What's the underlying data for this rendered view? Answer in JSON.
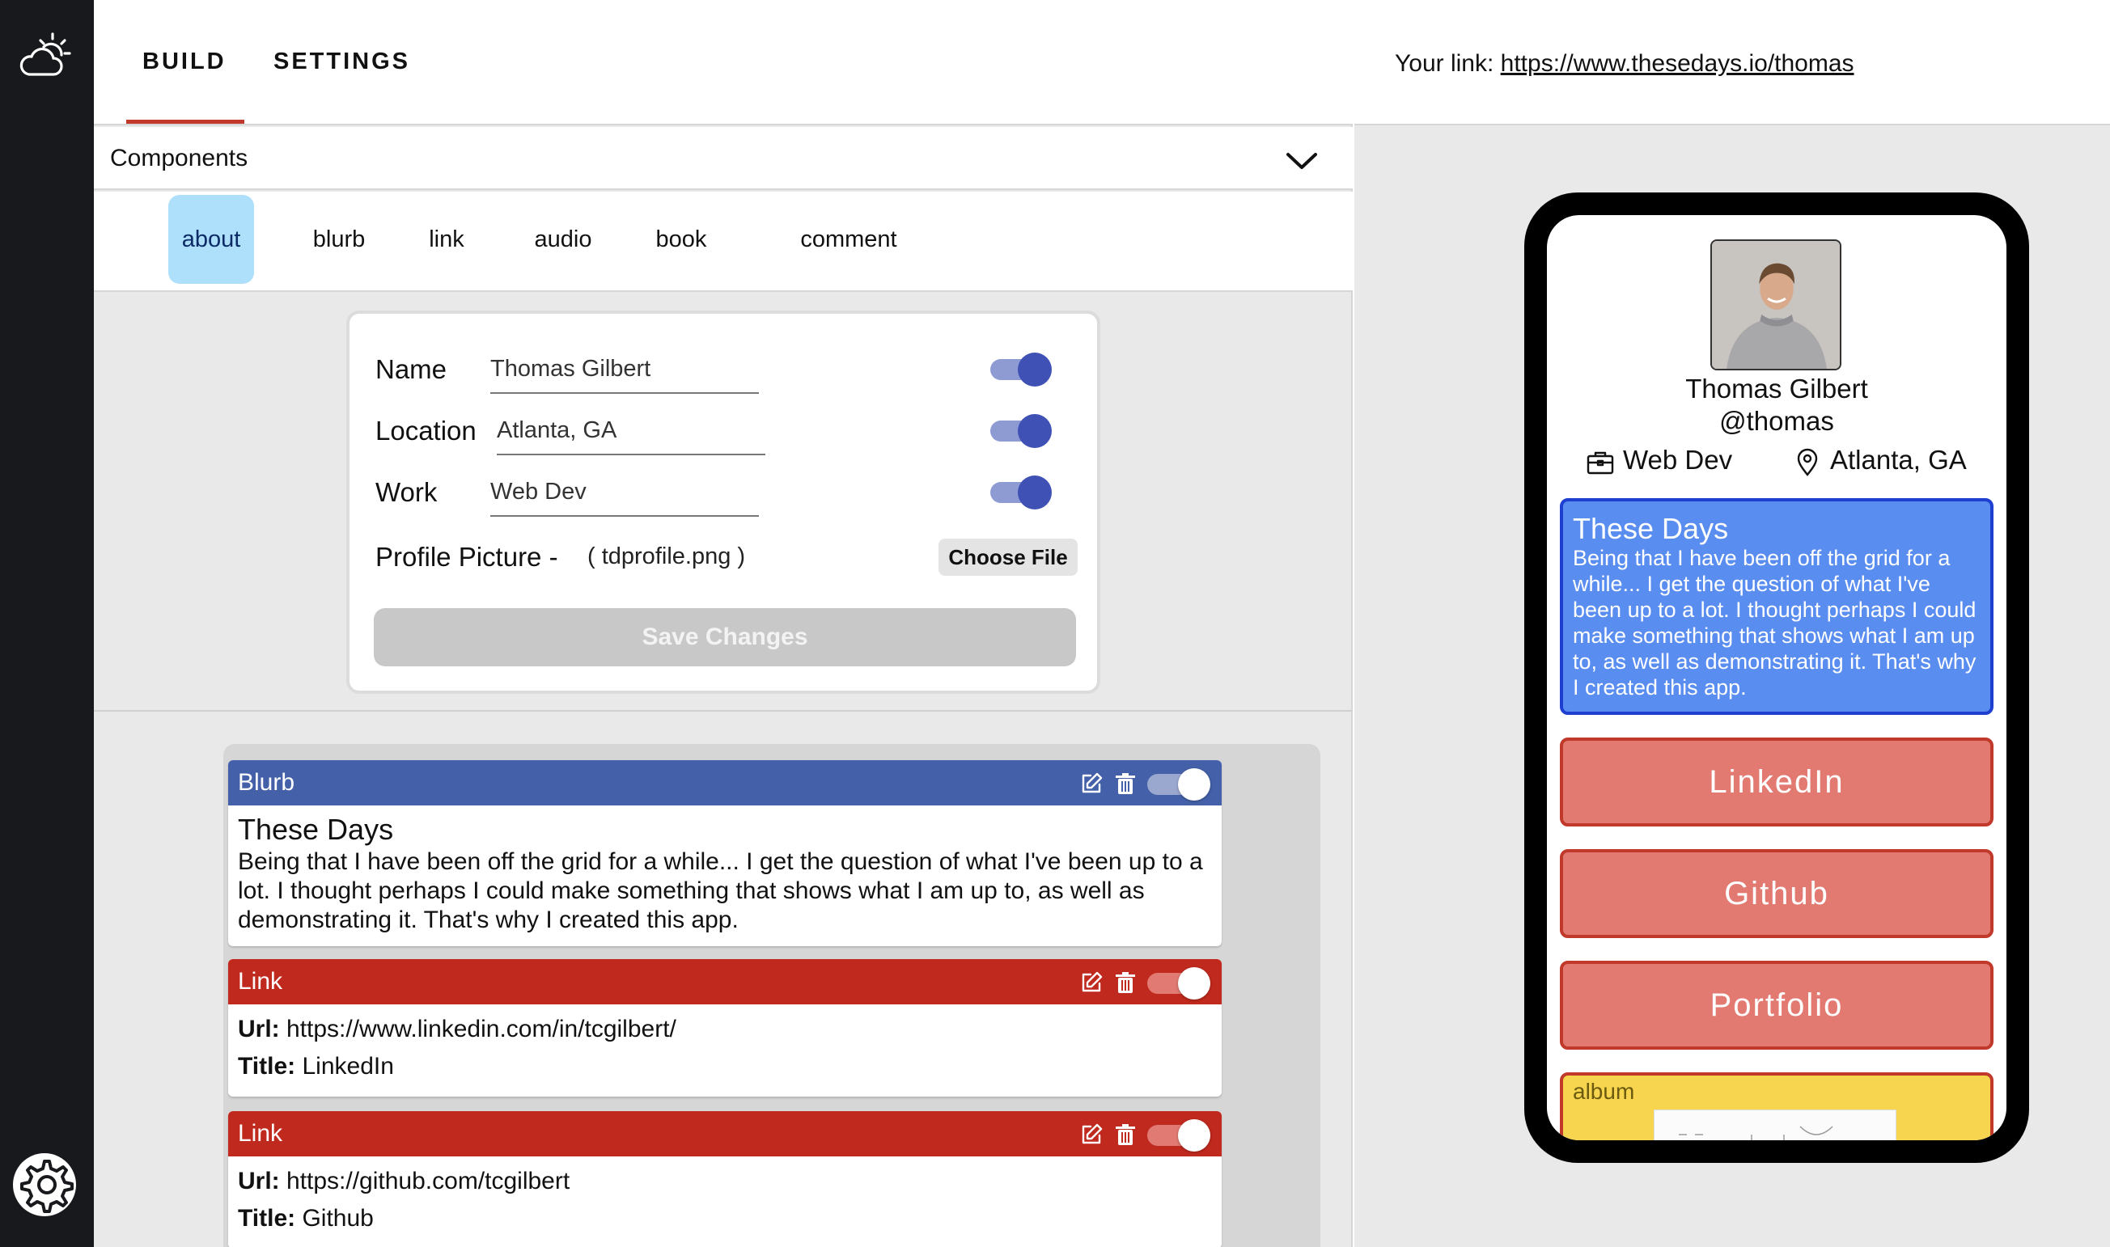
{
  "nav": {
    "tabs": [
      "BUILD",
      "SETTINGS"
    ],
    "active_tab": "BUILD"
  },
  "components": {
    "header": "Components",
    "tabs": [
      "about",
      "blurb",
      "link",
      "audio",
      "book",
      "comment"
    ],
    "active": "about"
  },
  "about_form": {
    "name_label": "Name",
    "name_value": "Thomas Gilbert",
    "location_label": "Location",
    "location_value": "Atlanta, GA",
    "work_label": "Work",
    "work_value": "Web Dev",
    "picture_label": "Profile Picture -",
    "picture_value": "( tdprofile.png )",
    "choose_file": "Choose File",
    "save": "Save Changes",
    "toggles": [
      true,
      true,
      true
    ]
  },
  "items": [
    {
      "kind": "Blurb",
      "color": "#4460a8",
      "title": "These Days",
      "body": "Being that I have been off the grid for a while... I get the question of what I've been up to a lot. I thought perhaps I could make something that shows what I am up to, as well as demonstrating it. That's why I created this app.",
      "enabled": true
    },
    {
      "kind": "Link",
      "color": "#c0291e",
      "url_label": "Url:",
      "url": "https://www.linkedin.com/in/tcgilbert/",
      "title_label": "Title:",
      "title": "LinkedIn",
      "enabled": true
    },
    {
      "kind": "Link",
      "color": "#c0291e",
      "url_label": "Url:",
      "url": "https://github.com/tcgilbert",
      "title_label": "Title:",
      "title": "Github",
      "enabled": true
    }
  ],
  "preview": {
    "your_link_label": "Your link:",
    "your_link": "https://www.thesedays.io/thomas",
    "name": "Thomas Gilbert",
    "handle": "@thomas",
    "work": "Web Dev",
    "location": "Atlanta, GA",
    "blurb_title": "These Days",
    "blurb_body": "Being that I have been off the grid for a while... I get the question of what I've been up to a lot. I thought perhaps I could make something that shows what I am up to, as well as demonstrating it. That's why I created this app.",
    "links": [
      "LinkedIn",
      "Github",
      "Portfolio"
    ],
    "album_label": "album",
    "colors": {
      "blurb": "#5a8df0",
      "link": "#e37a72",
      "album": "#f7d54f"
    }
  },
  "icons": {
    "logo": "sun-cloud-icon",
    "settings": "gear-icon",
    "expand": "chevron-down-icon",
    "edit": "edit-icon",
    "delete": "trash-icon",
    "work": "briefcase-icon",
    "location": "location-pin-icon"
  }
}
